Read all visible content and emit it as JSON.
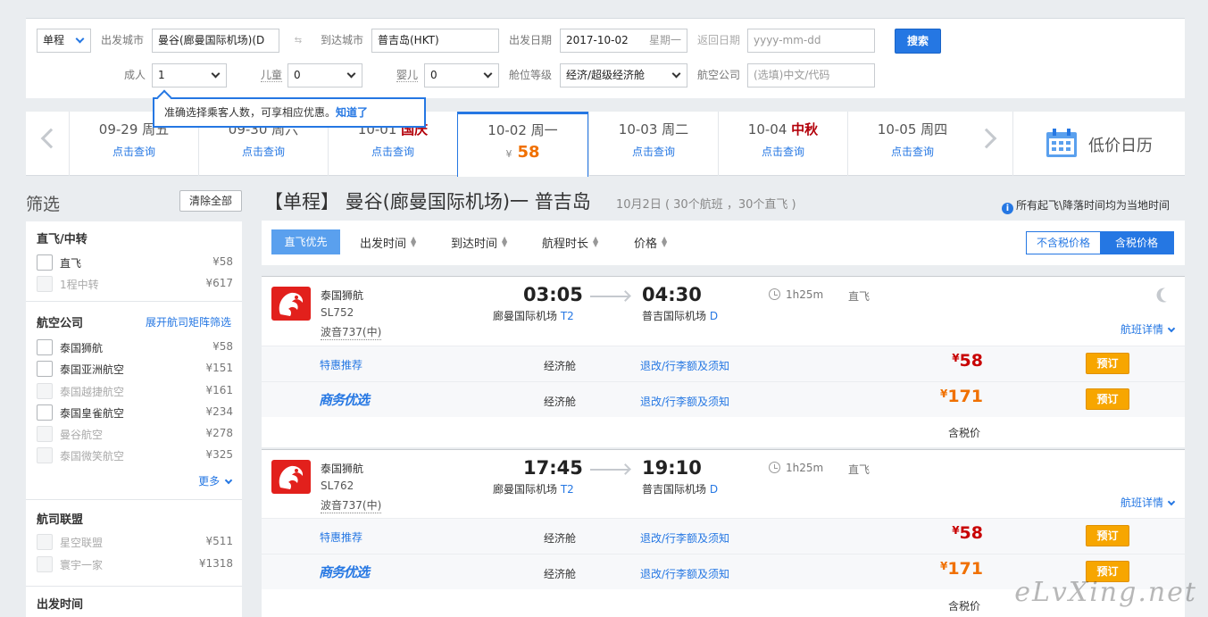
{
  "search": {
    "trip_type": "单程",
    "from_label": "出发城市",
    "from_value": "曼谷(廊曼国际机场)(D",
    "to_label": "到达城市",
    "to_value": "普吉岛(HKT)",
    "depart_label": "出发日期",
    "depart_value": "2017-10-02",
    "depart_weekday": "星期一",
    "return_label": "返回日期",
    "return_placeholder": "yyyy-mm-dd",
    "search_button": "搜索",
    "adult_label": "成人",
    "adult_value": "1",
    "child_label": "儿童",
    "child_value": "0",
    "infant_label": "婴儿",
    "infant_value": "0",
    "cabin_label": "舱位等级",
    "cabin_value": "经济/超级经济舱",
    "airline_label": "航空公司",
    "airline_placeholder": "(选填)中文/代码"
  },
  "tooltip": {
    "text": "准确选择乘客人数，可享相应优惠。",
    "link": "知道了"
  },
  "dates": [
    {
      "date": "09-29",
      "day": "周五",
      "holiday": "",
      "action": "点击查询"
    },
    {
      "date": "09-30",
      "day": "周六",
      "holiday": "",
      "action": "点击查询"
    },
    {
      "date": "10-01",
      "day": "",
      "holiday": "国庆",
      "action": "点击查询"
    },
    {
      "date": "10-02",
      "day": "周一",
      "holiday": "",
      "currency": "¥",
      "price": "58"
    },
    {
      "date": "10-03",
      "day": "周二",
      "holiday": "",
      "action": "点击查询"
    },
    {
      "date": "10-04",
      "day": "",
      "holiday": "中秋",
      "action": "点击查询"
    },
    {
      "date": "10-05",
      "day": "周四",
      "holiday": "",
      "action": "点击查询"
    }
  ],
  "low_price_calendar": "低价日历",
  "filter": {
    "title": "筛选",
    "clear": "清除全部",
    "stops": {
      "head": "直飞/中转",
      "items": [
        {
          "name": "直飞",
          "price": "¥58"
        },
        {
          "name": "1程中转",
          "price": "¥617"
        }
      ]
    },
    "airlines": {
      "head": "航空公司",
      "link": "展开航司矩阵筛选",
      "more": "更多",
      "items": [
        {
          "name": "泰国狮航",
          "price": "¥58"
        },
        {
          "name": "泰国亚洲航空",
          "price": "¥151"
        },
        {
          "name": "泰国越捷航空",
          "price": "¥161"
        },
        {
          "name": "泰国皇雀航空",
          "price": "¥234"
        },
        {
          "name": "曼谷航空",
          "price": "¥278"
        },
        {
          "name": "泰国微笑航空",
          "price": "¥325"
        }
      ]
    },
    "alliance": {
      "head": "航司联盟",
      "items": [
        {
          "name": "星空联盟",
          "price": "¥511"
        },
        {
          "name": "寰宇一家",
          "price": "¥1318"
        }
      ]
    },
    "depart_time_head": "出发时间"
  },
  "results": {
    "title": "【单程】 曼谷(廊曼国际机场)一 普吉岛",
    "subtitle": "10月2日 ( 30个航班 ，30个直飞 )",
    "tz_note": "所有起飞\\降落时间均为当地时间"
  },
  "sort": {
    "direct_first": "直飞优先",
    "depart_time": "出发时间",
    "arrive_time": "到达时间",
    "duration": "航程时长",
    "price": "价格",
    "excl_tax": "不含税价格",
    "incl_tax": "含税价格"
  },
  "flights": [
    {
      "airline": "泰国狮航",
      "flight_no": "SL752",
      "aircraft": "波音737(中)",
      "dep_time": "03:05",
      "dep_airport": "廊曼国际机场",
      "dep_terminal": "T2",
      "arr_time": "04:30",
      "arr_airport": "普吉国际机场",
      "arr_terminal": "D",
      "duration": "1h25m",
      "type": "直飞",
      "details": "航班详情",
      "fares": [
        {
          "tag": "特惠推荐",
          "class": "经济舱",
          "rules": "退改/行李额及须知",
          "currency": "¥",
          "price": "58",
          "book": "预订"
        },
        {
          "tag": "商务优选",
          "class": "经济舱",
          "rules": "退改/行李额及须知",
          "currency": "¥",
          "price": "171",
          "book": "预订"
        }
      ],
      "tax_note": "含税价"
    },
    {
      "airline": "泰国狮航",
      "flight_no": "SL762",
      "aircraft": "波音737(中)",
      "dep_time": "17:45",
      "dep_airport": "廊曼国际机场",
      "dep_terminal": "T2",
      "arr_time": "19:10",
      "arr_airport": "普吉国际机场",
      "arr_terminal": "D",
      "duration": "1h25m",
      "type": "直飞",
      "details": "航班详情",
      "fares": [
        {
          "tag": "特惠推荐",
          "class": "经济舱",
          "rules": "退改/行李额及须知",
          "currency": "¥",
          "price": "58",
          "book": "预订"
        },
        {
          "tag": "商务优选",
          "class": "经济舱",
          "rules": "退改/行李额及须知",
          "currency": "¥",
          "price": "171",
          "book": "预订"
        }
      ],
      "tax_note": "含税价"
    }
  ],
  "watermark": "eLvXing.net",
  "colors": {
    "accent": "#2577e3",
    "price_red": "#c80000",
    "price_orange": "#f07000",
    "book_button": "#f7a600"
  }
}
